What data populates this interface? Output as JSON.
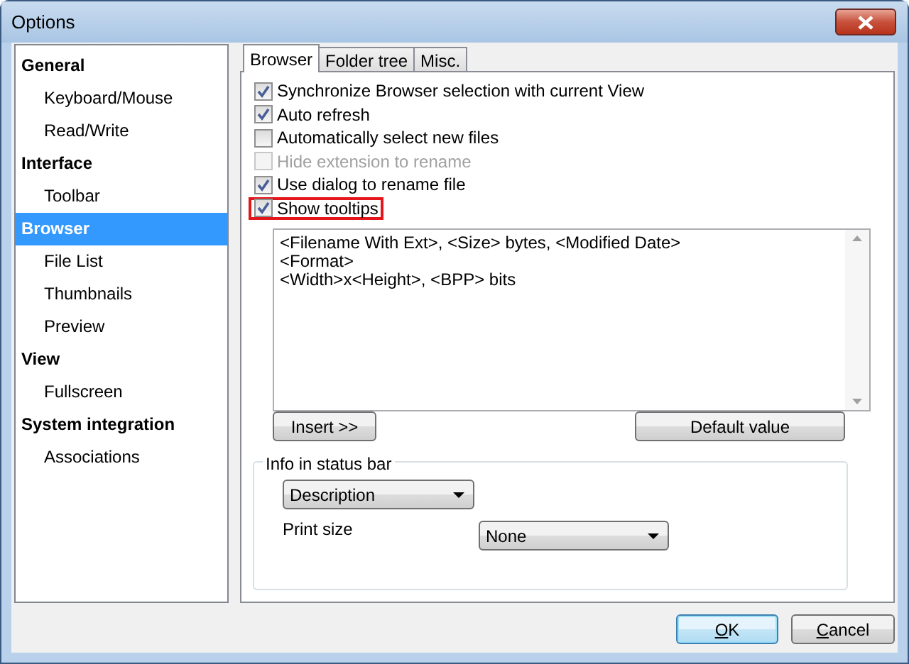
{
  "window": {
    "title": "Options"
  },
  "sidebar": {
    "items": [
      {
        "label": "General",
        "selected": false,
        "children": [
          {
            "label": "Keyboard/Mouse",
            "selected": false
          },
          {
            "label": "Read/Write",
            "selected": false
          }
        ]
      },
      {
        "label": "Interface",
        "selected": false,
        "children": [
          {
            "label": "Toolbar",
            "selected": false
          }
        ]
      },
      {
        "label": "Browser",
        "selected": true,
        "children": [
          {
            "label": "File List",
            "selected": false
          },
          {
            "label": "Thumbnails",
            "selected": false
          },
          {
            "label": "Preview",
            "selected": false
          }
        ]
      },
      {
        "label": "View",
        "selected": false,
        "children": [
          {
            "label": "Fullscreen",
            "selected": false
          }
        ]
      },
      {
        "label": "System integration",
        "selected": false,
        "children": [
          {
            "label": "Associations",
            "selected": false
          }
        ]
      }
    ]
  },
  "tabs": [
    {
      "label": "Browser",
      "selected": true
    },
    {
      "label": "Folder tree",
      "selected": false
    },
    {
      "label": "Misc.",
      "selected": false
    }
  ],
  "options": [
    {
      "label": "Synchronize Browser selection with current View",
      "checked": true,
      "disabled": false,
      "highlighted": false
    },
    {
      "label": "Auto refresh",
      "checked": true,
      "disabled": false,
      "highlighted": false
    },
    {
      "label": "Automatically select new files",
      "checked": false,
      "disabled": false,
      "highlighted": false
    },
    {
      "label": "Hide extension to rename",
      "checked": false,
      "disabled": true,
      "highlighted": false
    },
    {
      "label": "Use dialog to rename file",
      "checked": true,
      "disabled": false,
      "highlighted": false
    },
    {
      "label": "Show tooltips",
      "checked": true,
      "disabled": false,
      "highlighted": true
    }
  ],
  "tooltip_template": {
    "lines": [
      "<Filename With Ext>, <Size> bytes, <Modified Date>",
      "<Format>",
      "<Width>x<Height>, <BPP> bits"
    ]
  },
  "insert_button": "Insert >>",
  "default_button": "Default value",
  "status_group": {
    "title": "Info in status bar",
    "info_select": "Description",
    "print_size_label": "Print size",
    "print_size_select": "None"
  },
  "buttons": [
    {
      "parts": [
        {
          "text": "O",
          "underlined": true
        },
        {
          "text": "K",
          "underlined": false
        }
      ],
      "default": true
    },
    {
      "parts": [
        {
          "text": "C",
          "underlined": true
        },
        {
          "text": "ancel",
          "underlined": false
        }
      ],
      "default": false
    }
  ]
}
